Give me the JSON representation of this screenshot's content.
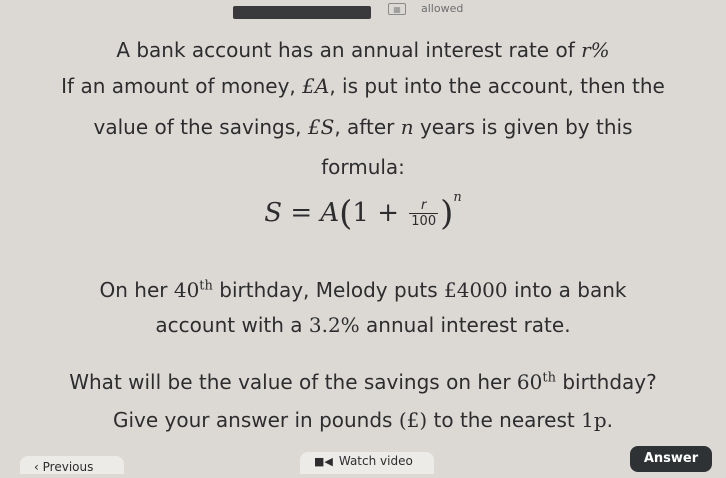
{
  "topbar": {
    "calculator_label": "allowed",
    "calculator_icon": "calculator-icon"
  },
  "question": {
    "line1": {
      "pre": "A bank account has an annual interest rate of ",
      "math": "r%"
    },
    "line2": {
      "pre": "If an amount of money, ",
      "math1": "£A",
      "mid": ", is put into the account, then the"
    },
    "line3": {
      "pre": "value of the savings, ",
      "math1": "£S",
      "mid": ", after ",
      "math2": "n",
      "post": " years is given by this"
    },
    "line4": "formula:",
    "formula": {
      "lhs": "S = A",
      "num": "r",
      "den": "100",
      "power": "n",
      "one_plus": "1 +"
    },
    "line5": {
      "pre": "On her ",
      "ordinal": "40",
      "ordinal_sup": "th",
      "mid": " birthday, Melody puts ",
      "amount": "£4000",
      "post": " into a bank"
    },
    "line6": {
      "pre": "account with a ",
      "rate": "3.2%",
      "post": " annual interest rate."
    },
    "line7": {
      "pre": "What will be the value of the savings on her ",
      "ordinal": "60",
      "ordinal_sup": "th",
      "post": " birthday?"
    },
    "line8": {
      "pre": "Give your answer in pounds ",
      "unit": "(£)",
      "mid": " to the nearest ",
      "precision": "1p",
      "post": "."
    }
  },
  "bottombar": {
    "previous_label": "Previous",
    "watch_label": "Watch video",
    "answer_label": "Answer"
  }
}
